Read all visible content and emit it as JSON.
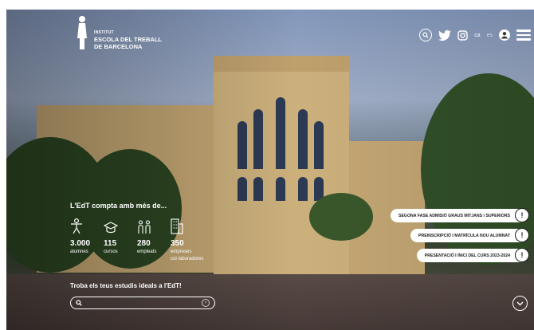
{
  "logo": {
    "line1": "INSTITUT",
    "line2": "ESCOLA DEL TREBALL",
    "line3": "DE BARCELONA"
  },
  "header": {
    "languages": [
      "ca",
      "es"
    ],
    "selected_language": "ca"
  },
  "stats": {
    "title": "L'EdT compta amb més de...",
    "items": [
      {
        "icon": "student-icon",
        "value": "3.000",
        "label": "alumnes"
      },
      {
        "icon": "graduation-cap-icon",
        "value": "115",
        "label": "cursos"
      },
      {
        "icon": "people-icon",
        "value": "280",
        "label": "empleats"
      },
      {
        "icon": "building-icon",
        "value": "350",
        "label": "empreses",
        "label2": "col·laboradores"
      }
    ]
  },
  "search": {
    "title": "Troba els teus estudis ideals a l'EdT!",
    "placeholder": ""
  },
  "notices": [
    {
      "label": "SEGONA FASE ADMISIÓ GRAUS MITJANS i SUPERIORS"
    },
    {
      "label": "PREINSCRIPCIÓ I MATRÍCULA NOU ALUMNAT"
    },
    {
      "label": "PRESENTACIÓ I INICI DEL CURS 2023-2024"
    }
  ],
  "colors": {
    "accent": "#ffffff",
    "notice_bg": "#ffffff",
    "notice_text": "#1c1c1c"
  }
}
